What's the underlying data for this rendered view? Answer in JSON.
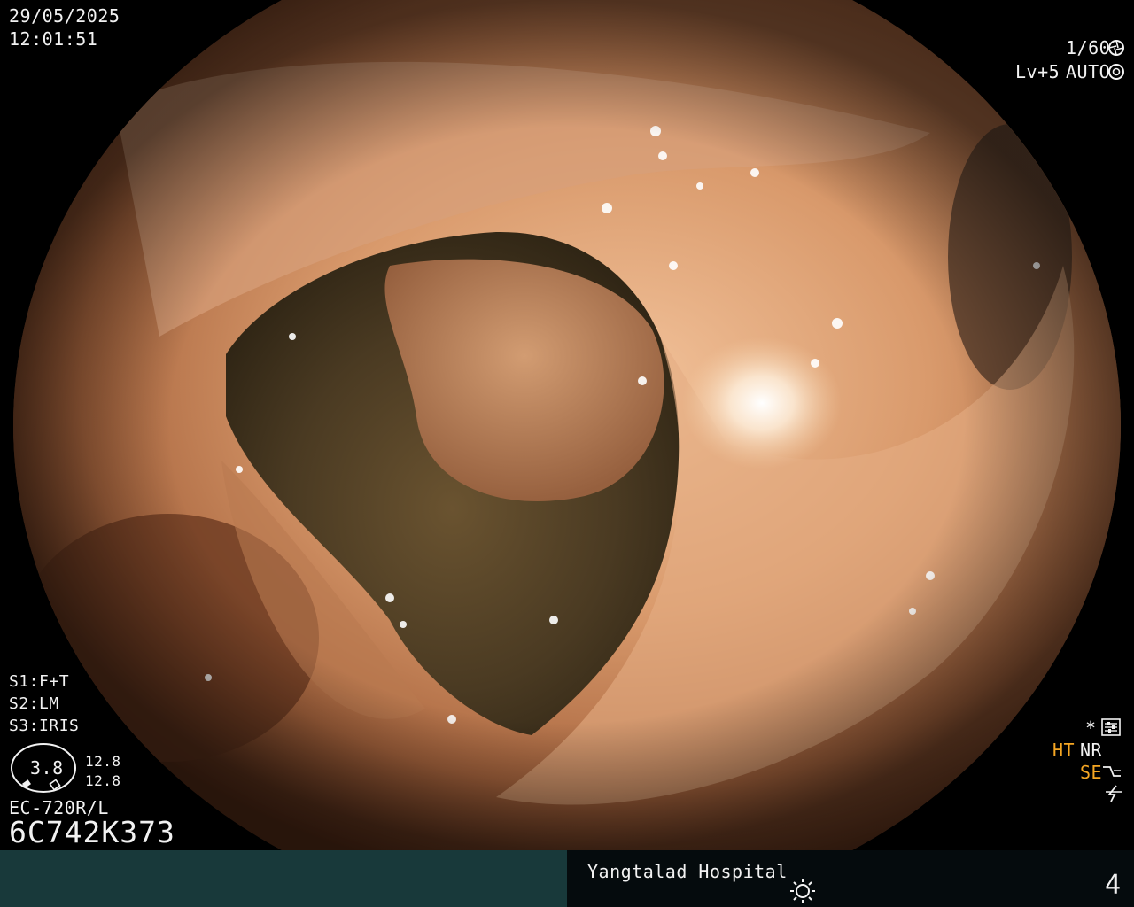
{
  "overlay": {
    "date": "29/05/2025",
    "time": "12:01:51",
    "shutter": "1/60",
    "level": "Lv+5",
    "exposure_mode": "AUTO",
    "settings": [
      {
        "key": "S1:",
        "value": "F+T"
      },
      {
        "key": "S2:",
        "value": "LM"
      },
      {
        "key": "S3:",
        "value": "IRIS"
      }
    ],
    "iris_value": "3.8",
    "readout_top": "12.8",
    "readout_bottom": "12.8",
    "scope_model": "EC-720R/L",
    "serial": "6C742K373",
    "right_status": {
      "star": "*",
      "ht": "HT",
      "nr": "NR",
      "se": "SE"
    }
  },
  "footer": {
    "hospital": "Yangtalad Hospital",
    "page_number": "4"
  },
  "colors": {
    "mucosa": "#c98a5e",
    "lumen": "#4a3a22",
    "status_orange": "#f5a623",
    "footer_left": "#18393a"
  },
  "icons": [
    "shutter-icon",
    "iris-icon",
    "settings-icon",
    "sun-icon",
    "structure-icon",
    "flash-off-icon"
  ]
}
